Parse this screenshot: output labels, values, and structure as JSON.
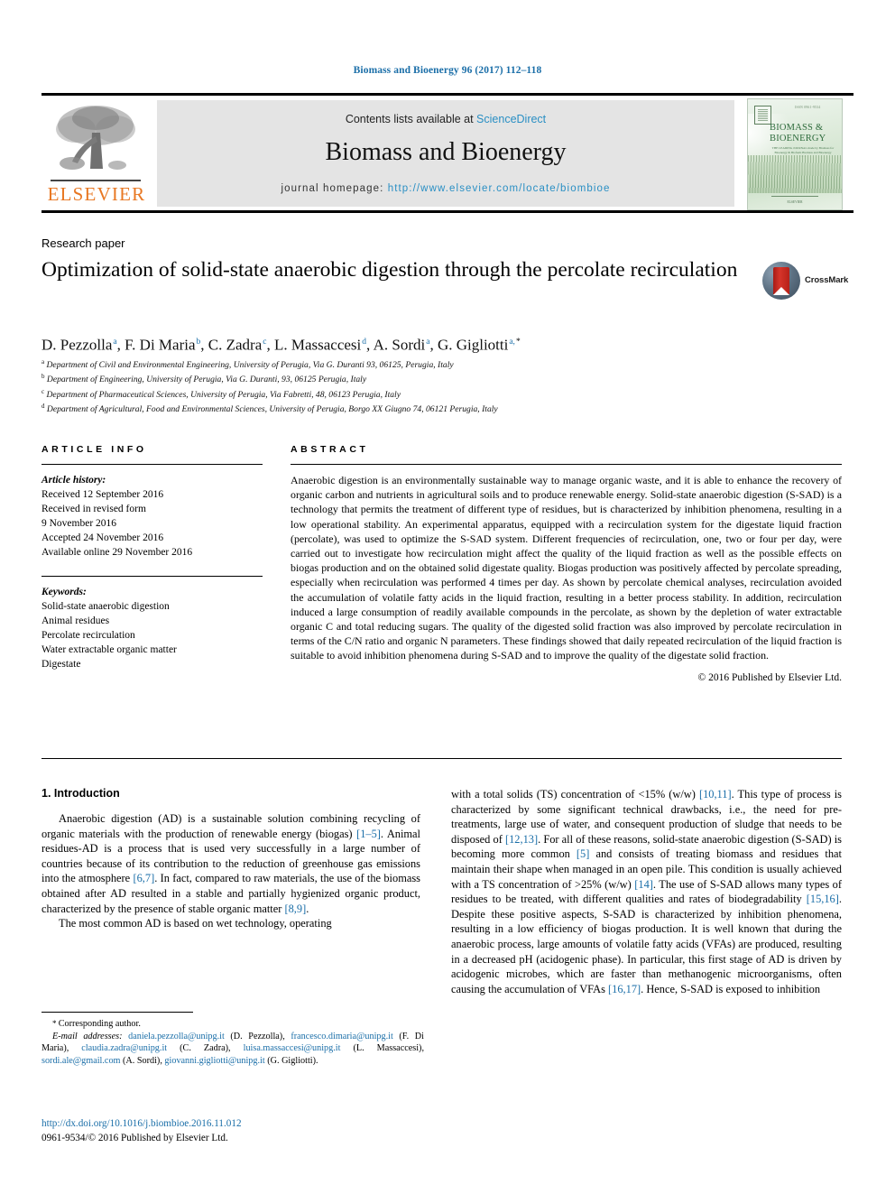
{
  "running_head": "Biomass and Bioenergy 96 (2017) 112–118",
  "masthead": {
    "contents_prefix": "Contents lists available at ",
    "contents_link": "ScienceDirect",
    "journal_title": "Biomass and Bioenergy",
    "homepage_prefix": "journal homepage: ",
    "homepage_url": "http://www.elsevier.com/locate/biombioe",
    "publisher_logo_text": "ELSEVIER",
    "publisher_logo_icon": "elsevier-tree-icon",
    "cover": {
      "title_line1": "BIOMASS &",
      "title_line2": "BIOENERGY",
      "subtitle": "THE LEADING JOURNAL\nmade by Biomass for Bioenergy & Biofuels\nBiomass and Bioenergy News",
      "top_code": "ISSN 0961-9534",
      "footer": "ELSEVIER"
    }
  },
  "article_type": "Research paper",
  "title": "Optimization of solid-state anaerobic digestion through the percolate recirculation",
  "crossmark": {
    "label": "CrossMark",
    "icon": "crossmark-badge-icon"
  },
  "authors": [
    {
      "name": "D. Pezzolla",
      "sup": "a",
      "star": false
    },
    {
      "name": "F. Di Maria",
      "sup": "b",
      "star": false
    },
    {
      "name": "C. Zadra",
      "sup": "c",
      "star": false
    },
    {
      "name": "L. Massaccesi",
      "sup": "d",
      "star": false
    },
    {
      "name": "A. Sordi",
      "sup": "a",
      "star": false
    },
    {
      "name": "G. Gigliotti",
      "sup": "a",
      "star": true
    }
  ],
  "affiliations": [
    {
      "mark": "a",
      "text": "Department of Civil and Environmental Engineering, University of Perugia, Via G. Duranti 93, 06125, Perugia, Italy"
    },
    {
      "mark": "b",
      "text": "Department of Engineering, University of Perugia, Via G. Duranti, 93, 06125 Perugia, Italy"
    },
    {
      "mark": "c",
      "text": "Department of Pharmaceutical Sciences, University of Perugia, Via Fabretti, 48, 06123 Perugia, Italy"
    },
    {
      "mark": "d",
      "text": "Department of Agricultural, Food and Environmental Sciences, University of Perugia, Borgo XX Giugno 74, 06121 Perugia, Italy"
    }
  ],
  "article_info": {
    "heading": "ARTICLE INFO",
    "history_label": "Article history:",
    "history": [
      "Received 12 September 2016",
      "Received in revised form",
      "9 November 2016",
      "Accepted 24 November 2016",
      "Available online 29 November 2016"
    ],
    "keywords_label": "Keywords:",
    "keywords": [
      "Solid-state anaerobic digestion",
      "Animal residues",
      "Percolate recirculation",
      "Water extractable organic matter",
      "Digestate"
    ]
  },
  "abstract": {
    "heading": "ABSTRACT",
    "text": "Anaerobic digestion is an environmentally sustainable way to manage organic waste, and it is able to enhance the recovery of organic carbon and nutrients in agricultural soils and to produce renewable energy. Solid-state anaerobic digestion (S-SAD) is a technology that permits the treatment of different type of residues, but is characterized by inhibition phenomena, resulting in a low operational stability. An experimental apparatus, equipped with a recirculation system for the digestate liquid fraction (percolate), was used to optimize the S-SAD system. Different frequencies of recirculation, one, two or four per day, were carried out to investigate how recirculation might affect the quality of the liquid fraction as well as the possible effects on biogas production and on the obtained solid digestate quality. Biogas production was positively affected by percolate spreading, especially when recirculation was performed 4 times per day. As shown by percolate chemical analyses, recirculation avoided the accumulation of volatile fatty acids in the liquid fraction, resulting in a better process stability. In addition, recirculation induced a large consumption of readily available compounds in the percolate, as shown by the depletion of water extractable organic C and total reducing sugars. The quality of the digested solid fraction was also improved by percolate recirculation in terms of the C/N ratio and organic N parameters. These findings showed that daily repeated recirculation of the liquid fraction is suitable to avoid inhibition phenomena during S-SAD and to improve the quality of the digestate solid fraction.",
    "copyright": "© 2016 Published by Elsevier Ltd."
  },
  "introduction": {
    "heading": "1. Introduction",
    "left_paragraphs": [
      {
        "segments": [
          {
            "t": "Anaerobic digestion (AD) is a sustainable solution combining recycling of organic materials with the production of renewable energy (biogas) ",
            "ref": false
          },
          {
            "t": "[1–5]",
            "ref": true
          },
          {
            "t": ". Animal residues-AD is a process that is used very successfully in a large number of countries because of its contribution to the reduction of greenhouse gas emissions into the atmosphere ",
            "ref": false
          },
          {
            "t": "[6,7]",
            "ref": true
          },
          {
            "t": ". In fact, compared to raw materials, the use of the biomass obtained after AD resulted in a stable and partially hygienized organic product, characterized by the presence of stable organic matter ",
            "ref": false
          },
          {
            "t": "[8,9]",
            "ref": true
          },
          {
            "t": ".",
            "ref": false
          }
        ]
      },
      {
        "segments": [
          {
            "t": "The most common AD is based on wet technology, operating",
            "ref": false
          }
        ]
      }
    ],
    "right_paragraphs": [
      {
        "continuation": true,
        "segments": [
          {
            "t": "with a total solids (TS) concentration of <15% (w/w) ",
            "ref": false
          },
          {
            "t": "[10,11]",
            "ref": true
          },
          {
            "t": ". This type of process is characterized by some significant technical drawbacks, i.e., the need for pre-treatments, large use of water, and consequent production of sludge that needs to be disposed of ",
            "ref": false
          },
          {
            "t": "[12,13]",
            "ref": true
          },
          {
            "t": ". For all of these reasons, solid-state anaerobic digestion (S-SAD) is becoming more common ",
            "ref": false
          },
          {
            "t": "[5]",
            "ref": true
          },
          {
            "t": " and consists of treating biomass and residues that maintain their shape when managed in an open pile. This condition is usually achieved with a TS concentration of >25% (w/w) ",
            "ref": false
          },
          {
            "t": "[14]",
            "ref": true
          },
          {
            "t": ". The use of S-SAD allows many types of residues to be treated, with different qualities and rates of biodegradability ",
            "ref": false
          },
          {
            "t": "[15,16]",
            "ref": true
          },
          {
            "t": ". Despite these positive aspects, S-SAD is characterized by inhibition phenomena, resulting in a low efficiency of biogas production. It is well known that during the anaerobic process, large amounts of volatile fatty acids (VFAs) are produced, resulting in a decreased pH (acidogenic phase). In particular, this first stage of AD is driven by acidogenic microbes, which are faster than methanogenic microorganisms, often causing the accumulation of VFAs ",
            "ref": false
          },
          {
            "t": "[16,17]",
            "ref": true
          },
          {
            "t": ". Hence, S-SAD is exposed to inhibition",
            "ref": false
          }
        ]
      }
    ]
  },
  "footnote": {
    "corresponding_star": "*",
    "corresponding_text": "Corresponding author.",
    "email_label": "E-mail addresses:",
    "emails": [
      {
        "address": "daniela.pezzolla@unipg.it",
        "owner": "(D. Pezzolla)"
      },
      {
        "address": "francesco.dimaria@unipg.it",
        "owner": "(F. Di Maria)"
      },
      {
        "address": "claudia.zadra@unipg.it",
        "owner": "(C. Zadra)"
      },
      {
        "address": "luisa.massaccesi@unipg.it",
        "owner": "(L. Massaccesi)"
      },
      {
        "address": "sordi.ale@gmail.com",
        "owner": "(A. Sordi)"
      },
      {
        "address": "giovanni.gigliotti@unipg.it",
        "owner": "(G. Gigliotti)"
      }
    ]
  },
  "doi": "http://dx.doi.org/10.1016/j.biombioe.2016.11.012",
  "issn_line": "0961-9534/© 2016 Published by Elsevier Ltd."
}
